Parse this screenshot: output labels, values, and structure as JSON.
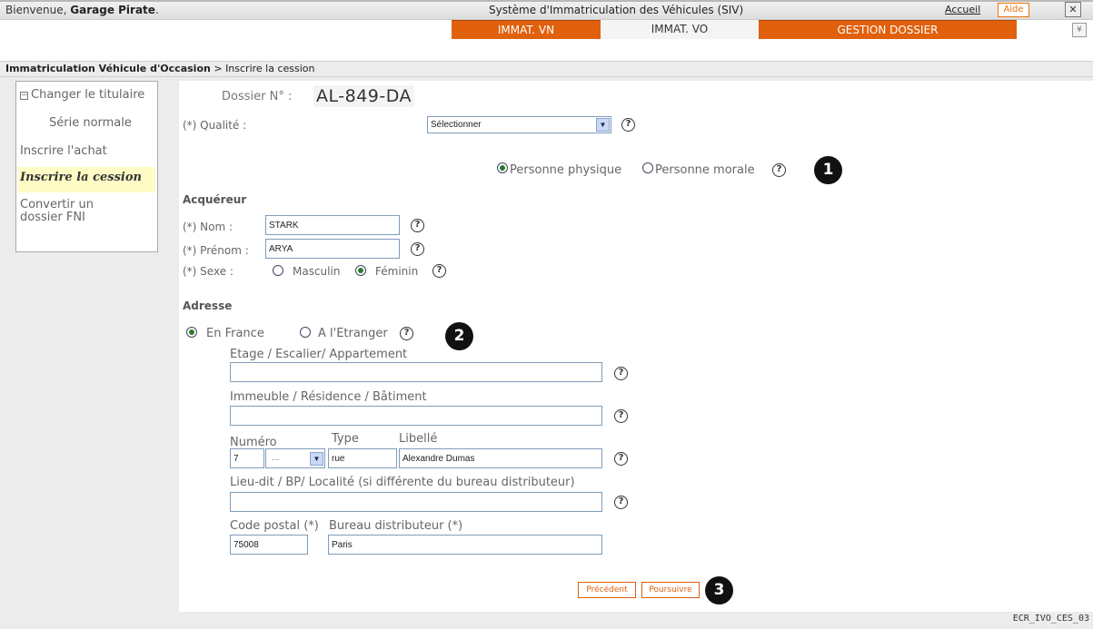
{
  "header": {
    "welcome_prefix": "Bienvenue, ",
    "welcome_user": "Garage Pirate",
    "welcome_suffix": ".",
    "system_title": "Système d'Immatriculation des Véhicules (SIV)",
    "accueil_link": "Accueil",
    "aide_button": "Aide",
    "close_icon": "close-icon"
  },
  "tabs": [
    {
      "label": "IMMAT. VN",
      "active": false
    },
    {
      "label": "IMMAT. VO",
      "active": true
    },
    {
      "label": "GESTION DOSSIER",
      "active": false
    }
  ],
  "breadcrumb": {
    "section": "Immatriculation Véhicule d'Occasion",
    "separator": " > ",
    "page": "Inscrire la cession"
  },
  "sidebar": {
    "group": "Changer le titulaire",
    "items": [
      {
        "label": "Série normale",
        "active": false
      },
      {
        "label": "Inscrire l'achat",
        "active": false
      },
      {
        "label": "Inscrire la cession",
        "active": true
      },
      {
        "label": "Convertir un",
        "label2": "dossier FNI",
        "active": false
      }
    ]
  },
  "dossier": {
    "label": "Dossier N° : ",
    "number": "AL-849-DA"
  },
  "qualite": {
    "label": "(*) Qualité :",
    "selected": "Sélectionner"
  },
  "personne": {
    "physique": "Personne physique",
    "morale": "Personne morale",
    "selected": "physique"
  },
  "acquereur": {
    "title": "Acquéreur",
    "nom_label": "(*) Nom :",
    "nom_value": "STARK",
    "prenom_label": "(*) Prénom :",
    "prenom_value": "ARYA",
    "sexe_label": "(*) Sexe :",
    "masculin": "Masculin",
    "feminin": "Féminin",
    "sexe_selected": "feminin"
  },
  "adresse": {
    "title": "Adresse",
    "en_france": "En France",
    "etranger": "A l'Etranger",
    "selected": "en_france",
    "etage_label": "Etage / Escalier/ Appartement",
    "etage_value": "",
    "immeuble_label": "Immeuble / Résidence / Bâtiment",
    "immeuble_value": "",
    "numero_label": "Numéro",
    "type_label": "Type",
    "libelle_label": "Libellé",
    "numero_value": "7",
    "extension_value": "...",
    "type_value": "rue",
    "libelle_value": "Alexandre Dumas",
    "lieudit_label": "Lieu-dit / BP/ Localité (si différente du bureau distributeur)",
    "lieudit_value": "",
    "cp_label": "Code postal (*)",
    "bureau_label": "Bureau distributeur (*)",
    "cp_value": "75008",
    "bureau_value": "Paris"
  },
  "buttons": {
    "precedent": "Précédent",
    "poursuivre": "Poursuivre"
  },
  "markers": [
    "1",
    "2",
    "3"
  ],
  "help_glyph": "?",
  "footer_code": "ECR_IVO_CES_03",
  "colors": {
    "accent_orange": "#e0600c",
    "active_side_bg": "#fffcc6",
    "page_grey": "#ececec"
  }
}
